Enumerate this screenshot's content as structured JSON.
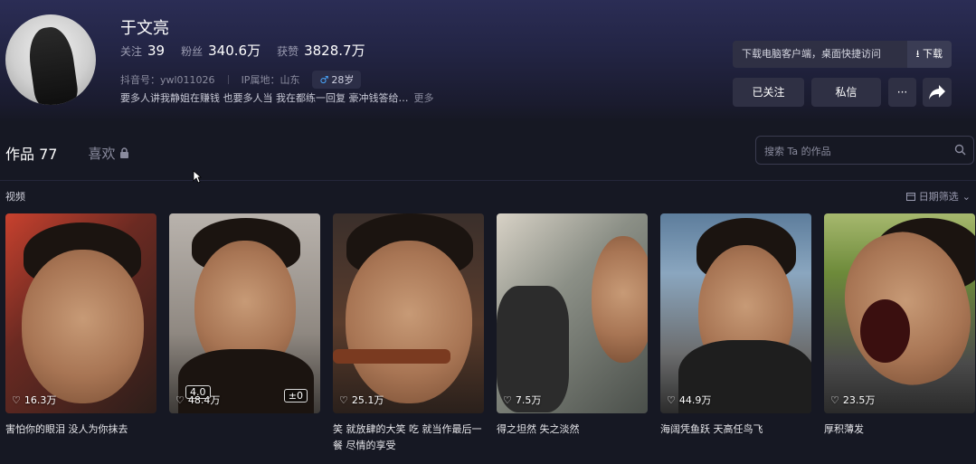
{
  "profile": {
    "name": "于文亮",
    "stats": [
      {
        "label": "关注",
        "value": "39"
      },
      {
        "label": "粉丝",
        "value": "340.6万"
      },
      {
        "label": "获赞",
        "value": "3828.7万"
      }
    ],
    "douyin_id": "抖音号：ywl011026",
    "ip_location": "IP属地：山东",
    "gender_age": "28岁",
    "bio": "要多人讲我静姐在赚钱 也要多人当 我在都练一回复 豪冲钱答给…",
    "bio_more": "更多"
  },
  "download": {
    "text": "下载电脑客户端，桌面快捷访问",
    "button": "下载"
  },
  "actions": {
    "follow": "已关注",
    "message": "私信",
    "more": "···"
  },
  "tabs": {
    "works": "作品 77",
    "likes": "喜欢"
  },
  "search": {
    "placeholder": "搜索 Ta 的作品"
  },
  "section": {
    "label": "视频",
    "filter": "日期筛选"
  },
  "videos": [
    {
      "likes": "16.3万",
      "caption": "害怕你的眼泪 没人为你抹去"
    },
    {
      "likes": "48.4万",
      "caption": "",
      "tag1": "4.0",
      "tag2": "±0"
    },
    {
      "likes": "25.1万",
      "caption": "笑 就放肆的大笑 吃 就当作最后一餐 尽情的享受"
    },
    {
      "likes": "7.5万",
      "caption": "得之坦然 失之淡然"
    },
    {
      "likes": "44.9万",
      "caption": "海阔凭鱼跃 天高任鸟飞"
    },
    {
      "likes": "23.5万",
      "caption": "厚积薄发"
    }
  ],
  "colors": {
    "background": "#161823",
    "button": "#2f3044",
    "male": "#4aa8ff"
  }
}
